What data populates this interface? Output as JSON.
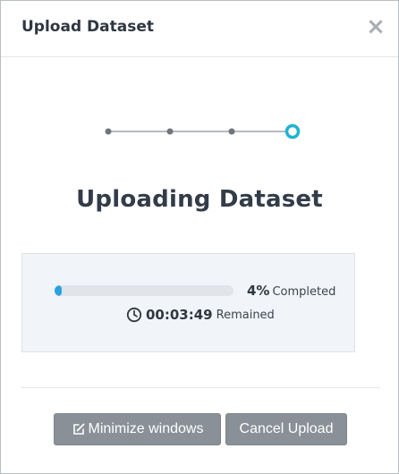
{
  "dialog": {
    "title": "Upload Dataset",
    "close_glyph": "×"
  },
  "stepper": {
    "steps": 4,
    "current_step": 4,
    "accent_color": "#1fb3d4",
    "dot_color": "#6f757c"
  },
  "main": {
    "heading": "Uploading Dataset"
  },
  "progress": {
    "percent_value": "4%",
    "percent_fraction": 0.04,
    "completed_label": "Completed",
    "time_value": "00:03:49",
    "remained_label": "Remained",
    "bar_color": "#29a3e0",
    "clock_icon": "clock-icon"
  },
  "footer": {
    "minimize_label": "Minimize windows",
    "minimize_icon": "edit-icon",
    "cancel_label": "Cancel Upload"
  }
}
